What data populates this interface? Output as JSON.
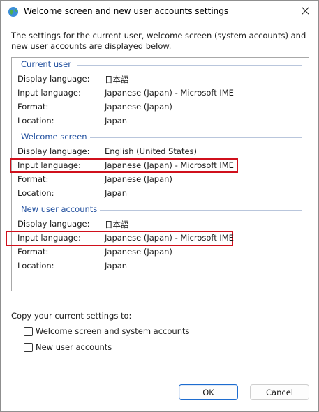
{
  "window": {
    "title": "Welcome screen and new user accounts settings",
    "intro": "The settings for the current user, welcome screen (system accounts) and new user accounts are displayed below."
  },
  "sections": [
    {
      "title": "Current user",
      "rows": [
        {
          "label": "Display language:",
          "value": "日本語"
        },
        {
          "label": "Input language:",
          "value": "Japanese (Japan) - Microsoft IME"
        },
        {
          "label": "Format:",
          "value": "Japanese (Japan)"
        },
        {
          "label": "Location:",
          "value": "Japan"
        }
      ]
    },
    {
      "title": "Welcome screen",
      "rows": [
        {
          "label": "Display language:",
          "value": "English (United States)"
        },
        {
          "label": "Input language:",
          "value": "Japanese (Japan) - Microsoft IME"
        },
        {
          "label": "Format:",
          "value": "Japanese (Japan)"
        },
        {
          "label": "Location:",
          "value": "Japan"
        }
      ]
    },
    {
      "title": "New user accounts",
      "rows": [
        {
          "label": "Display language:",
          "value": "日本語"
        },
        {
          "label": "Input language:",
          "value": "Japanese (Japan) - Microsoft IME"
        },
        {
          "label": "Format:",
          "value": "Japanese (Japan)"
        },
        {
          "label": "Location:",
          "value": "Japan"
        }
      ]
    }
  ],
  "copy": {
    "label": "Copy your current settings to:",
    "options": [
      {
        "label_access": "W",
        "label_rest": "elcome screen and system accounts",
        "checked": false
      },
      {
        "label_access": "N",
        "label_rest": "ew user accounts",
        "checked": false
      }
    ]
  },
  "buttons": {
    "ok": "OK",
    "cancel": "Cancel"
  },
  "colors": {
    "section_title": "#1f4e9e",
    "highlight": "#d0101c",
    "primary_border": "#1d6ccf"
  },
  "icons": {
    "app": "globe-icon",
    "close": "close-icon"
  }
}
